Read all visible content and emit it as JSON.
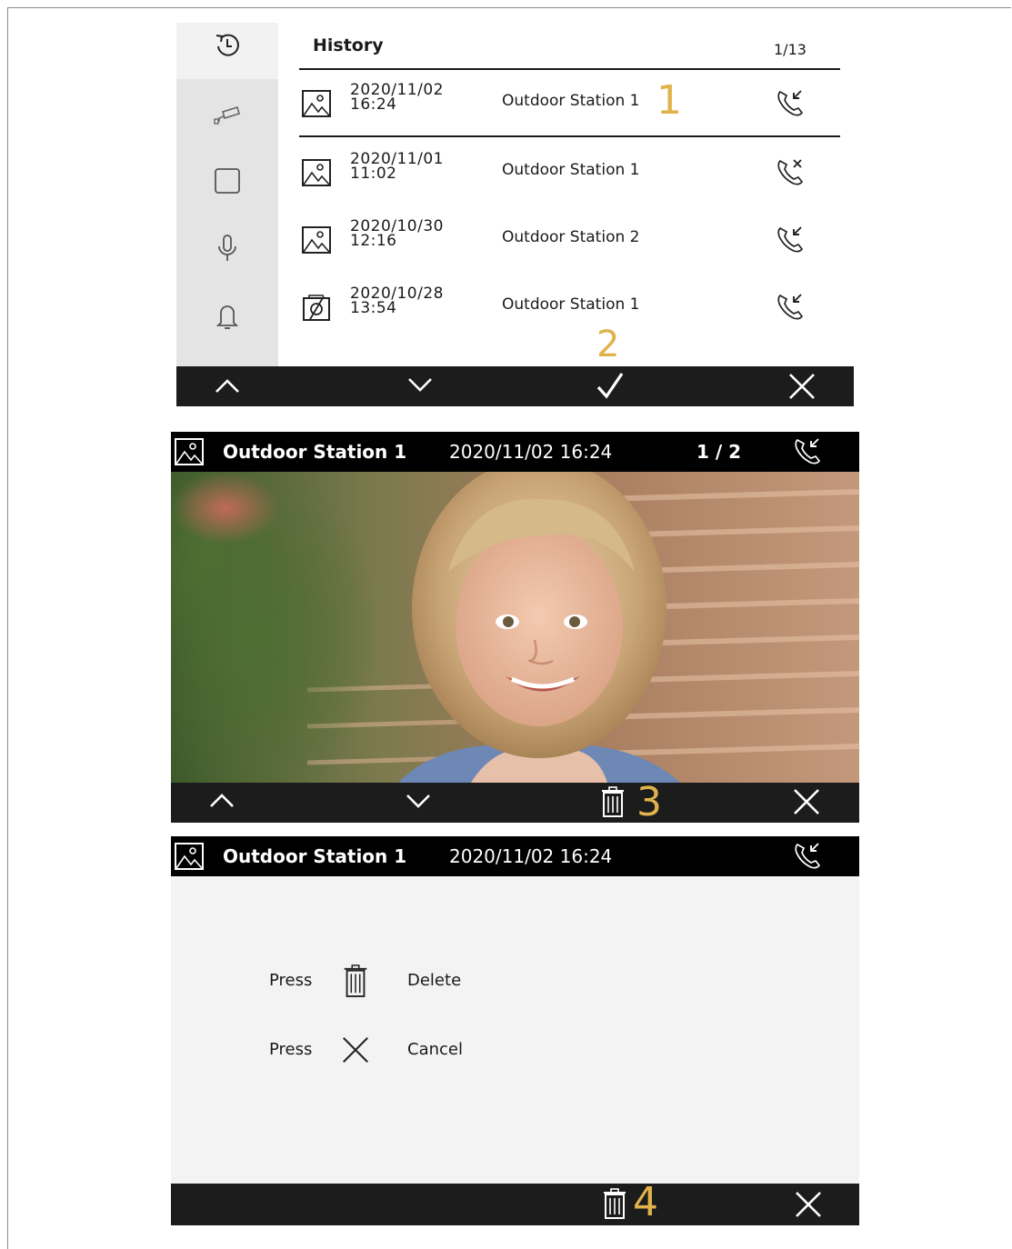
{
  "history": {
    "title": "History",
    "page": "1/13",
    "rows": [
      {
        "date": "2020/11/02",
        "time": "16:24",
        "station": "Outdoor Station 1",
        "call": "incoming",
        "image": "photo"
      },
      {
        "date": "2020/11/01",
        "time": "11:02",
        "station": "Outdoor Station 1",
        "call": "missed",
        "image": "photo"
      },
      {
        "date": "2020/10/30",
        "time": "12:16",
        "station": "Outdoor Station 2",
        "call": "incoming",
        "image": "photo"
      },
      {
        "date": "2020/10/28",
        "time": "13:54",
        "station": "Outdoor Station 1",
        "call": "incoming",
        "image": "no-photo"
      }
    ],
    "sidebar_icons": [
      "history-icon",
      "camera-icon",
      "square-icon",
      "microphone-icon",
      "bell-icon"
    ],
    "bottom_buttons": [
      "up-arrow-icon",
      "down-arrow-icon",
      "check-icon",
      "close-icon"
    ]
  },
  "viewer": {
    "station": "Outdoor Station 1",
    "datetime": "2020/11/02 16:24",
    "page": "1 / 2",
    "bottom_buttons": [
      "up-arrow-icon",
      "down-arrow-icon",
      "trash-icon",
      "close-icon"
    ]
  },
  "confirm": {
    "station": "Outdoor Station 1",
    "datetime": "2020/11/02 16:24",
    "line1_press": "Press",
    "line1_action": "Delete",
    "line2_press": "Press",
    "line2_action": "Cancel",
    "bottom_buttons": [
      "trash-icon",
      "close-icon"
    ]
  },
  "markers": {
    "m1": "1",
    "m2": "2",
    "m3": "3",
    "m4": "4"
  },
  "colors": {
    "marker": "#e0b34a",
    "bar": "#1c1c1c",
    "topbar": "#000000",
    "sidebar": "#e4e4e4"
  }
}
